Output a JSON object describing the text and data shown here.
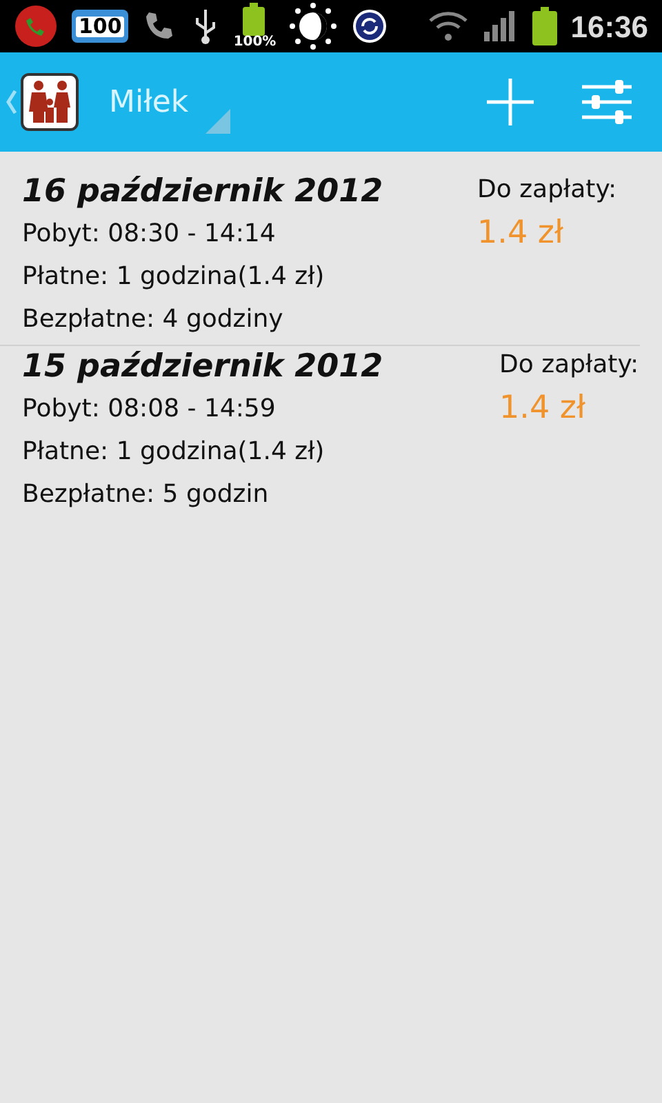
{
  "status_bar": {
    "battery_badge": "100",
    "battery_percent": "100%",
    "time": "16:36"
  },
  "action_bar": {
    "title": "Miłek"
  },
  "entries": [
    {
      "date": "16 październik 2012",
      "stay": "Pobyt: 08:30 - 14:14",
      "paid": "Płatne: 1 godzina(1.4 zł)",
      "free": "Bezpłatne: 4 godziny",
      "due_label": "Do zapłaty:",
      "due_amount": "1.4 zł"
    },
    {
      "date": "15 październik 2012",
      "stay": "Pobyt: 08:08 - 14:59",
      "paid": "Płatne: 1 godzina(1.4 zł)",
      "free": "Bezpłatne: 5 godzin",
      "due_label": "Do zapłaty:",
      "due_amount": "1.4 zł"
    }
  ]
}
